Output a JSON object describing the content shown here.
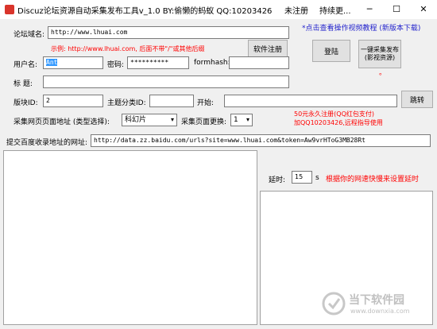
{
  "window": {
    "title": "Discuz论坛资源自动采集发布工具v_1.0    BY:偷懒的蚂蚁 QQ:10203426",
    "reg_status": "未注册",
    "update_label": "持续更...",
    "minimize": "─",
    "maximize": "☐",
    "close": "✕"
  },
  "form": {
    "forum_domain_label": "论坛域名:",
    "forum_domain_value": "http://www.lhuai.com",
    "example_text": "示例: http://www.lhuai.com, 后面不带\"/\"或其他后缀",
    "tutorial_link": "*点击查看操作视频教程 (新版本下载)",
    "register_button": "软件注册",
    "login_button": "登陆",
    "publish_button": "一键采集发布(影视资源)",
    "publish_dot": "。",
    "username_label": "用户名:",
    "username_value": "Ant",
    "password_label": "密码:",
    "password_value": "**********",
    "formhash_label": "formhash:",
    "formhash_value": "",
    "subject_label": "标  题:",
    "subject_value": "",
    "block_id_label": "版块ID:",
    "block_id_value": "2",
    "category_id_label": "主题分类ID:",
    "category_id_value": "",
    "start_label": "开始:",
    "start_value": "",
    "jump_button": "跳转",
    "pay_note_1": "50元永久注册(QQ红包支付)",
    "pay_note_2": "加QQ10203426,远程指导使用",
    "collect_url_label": "采集网页页面地址 (类型选择):",
    "collect_type_value": "科幻片",
    "page_change_label": "采集页面更换:",
    "page_change_value": "1",
    "baidu_label": "提交百度收录地址的网址:",
    "baidu_value": "http://data.zz.baidu.com/urls?site=www.lhuai.com&token=Aw9vrHToG3MB28Rt",
    "delay_label": "延时:",
    "delay_value": "15",
    "delay_unit": "s",
    "delay_note": "根据你的网速快慢来设置延时"
  },
  "watermark": {
    "text": "当下软件园",
    "sub": "www.downxia.com"
  }
}
